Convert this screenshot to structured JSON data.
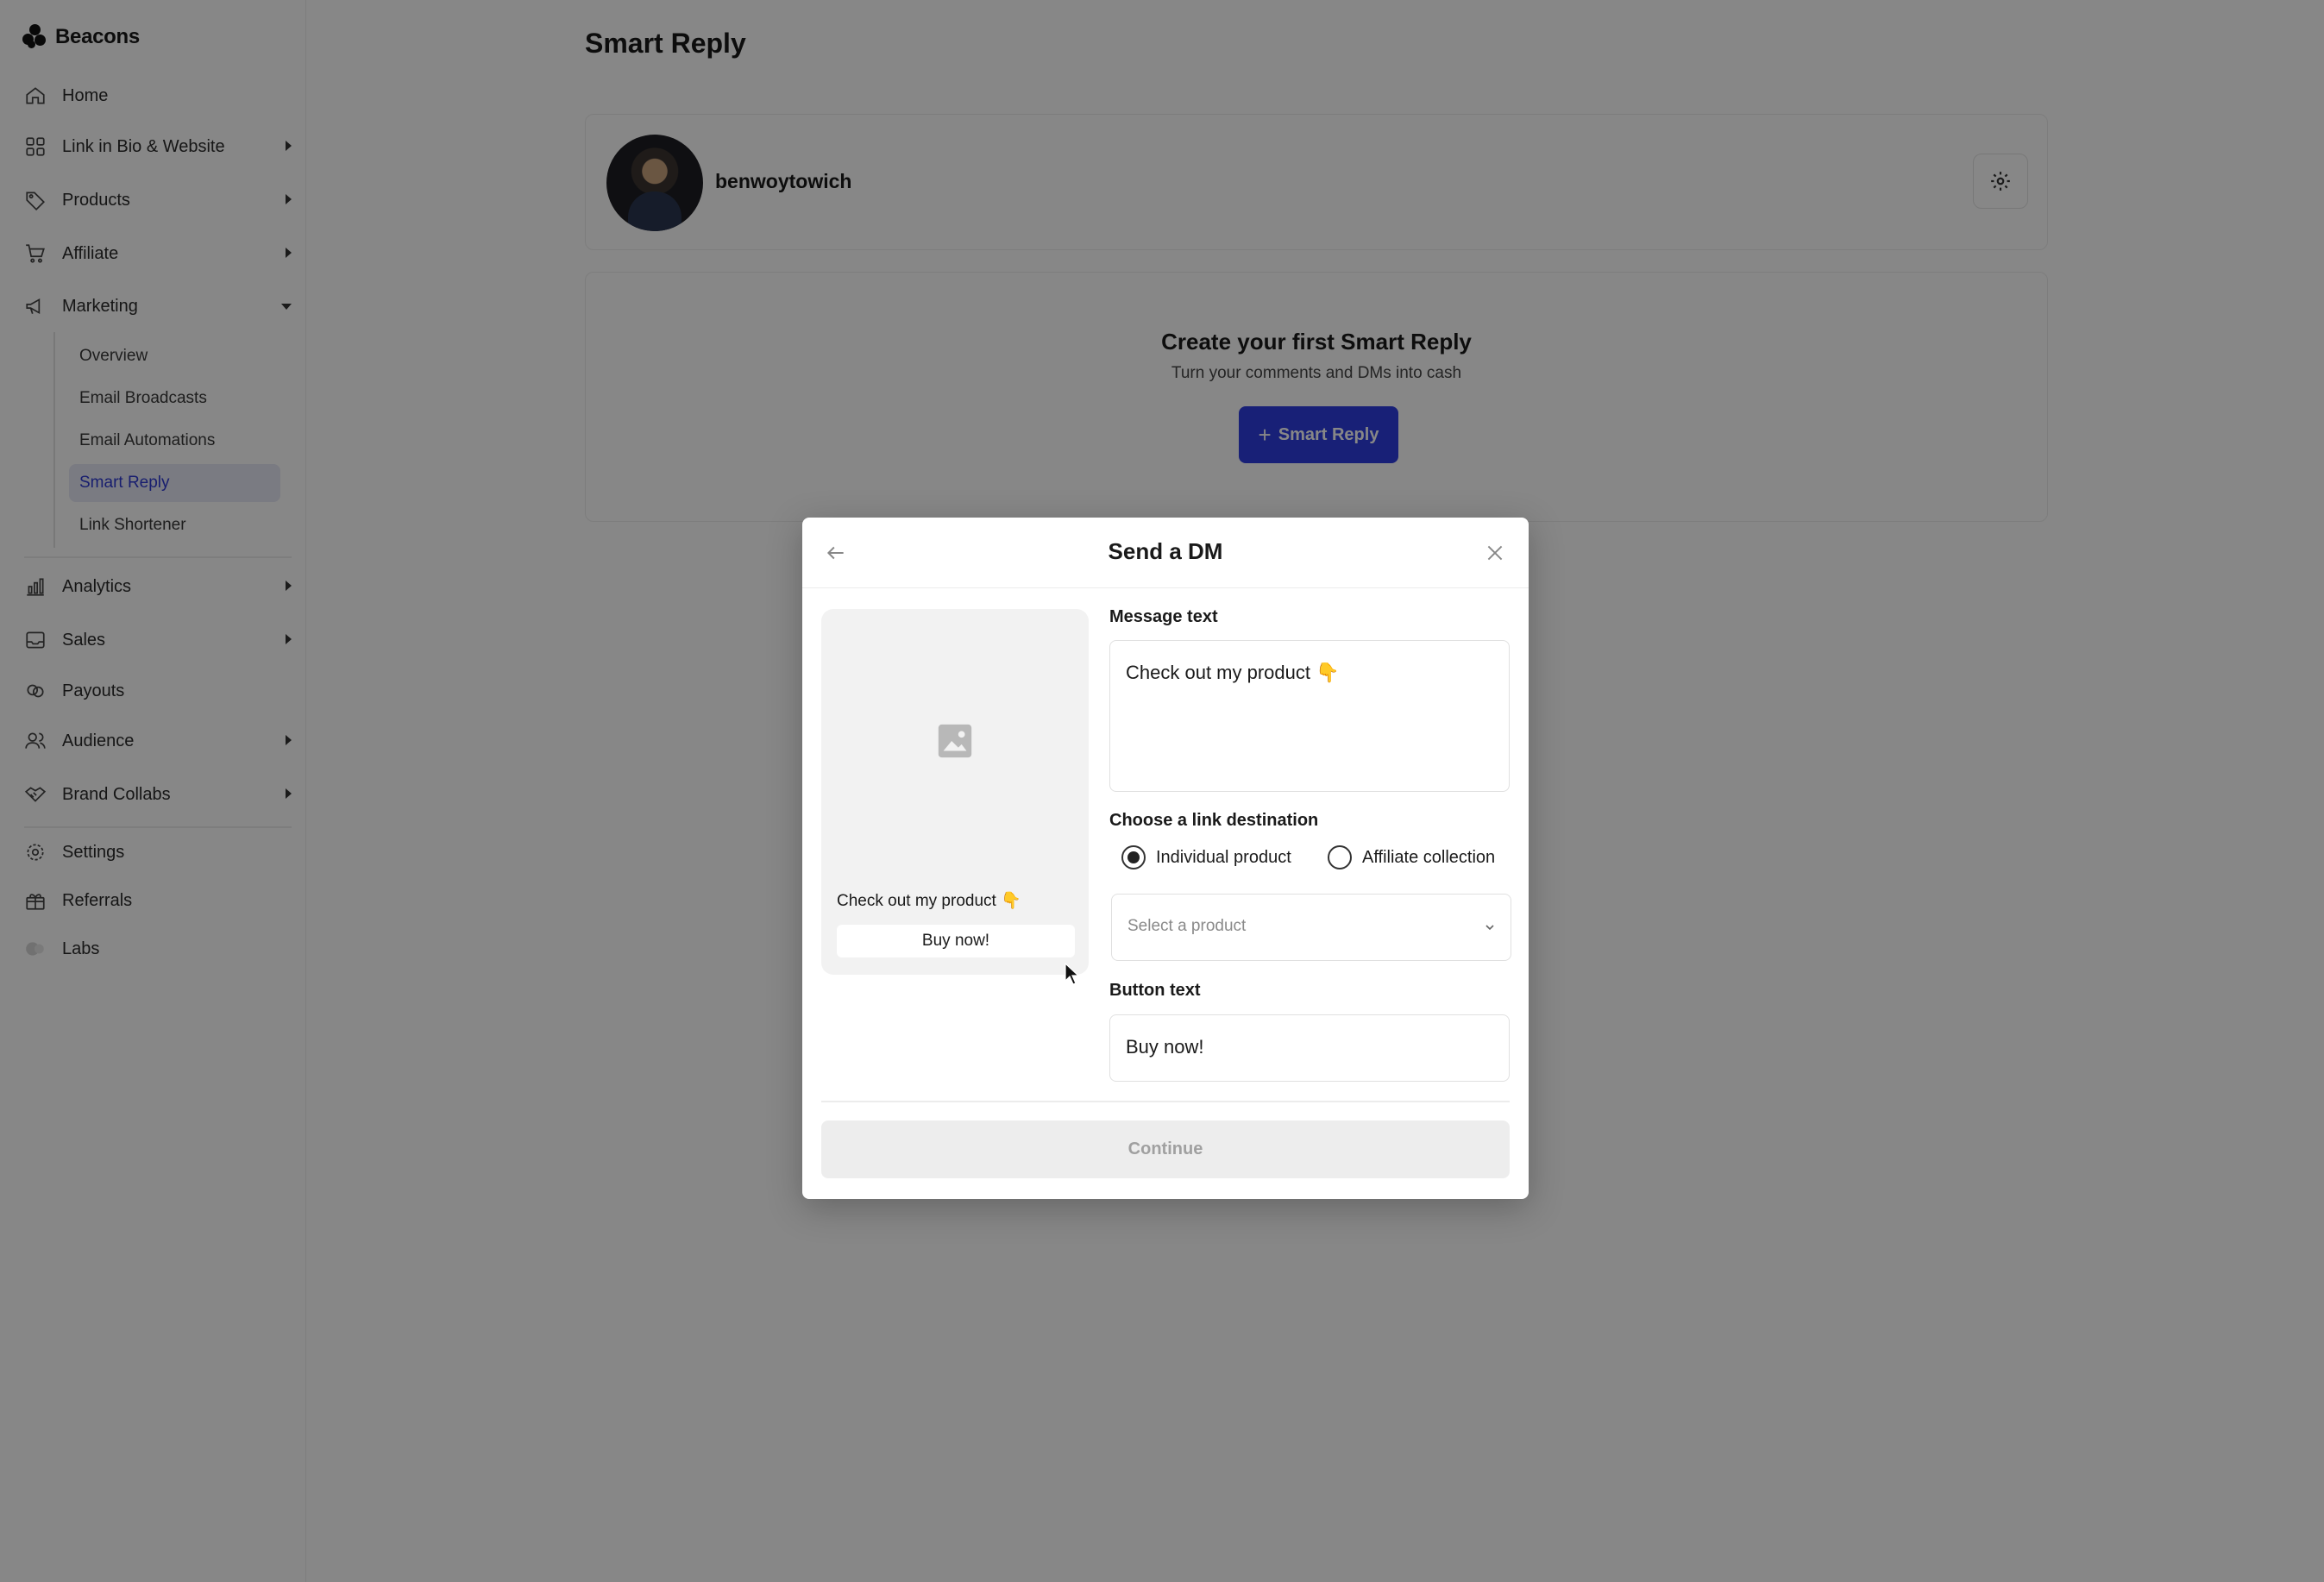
{
  "app": {
    "brand": "Beacons"
  },
  "sidebar": {
    "items": [
      {
        "label": "Home",
        "icon": "home-icon"
      },
      {
        "label": "Link in Bio & Website",
        "icon": "grid-icon"
      },
      {
        "label": "Products",
        "icon": "tag-icon"
      },
      {
        "label": "Affiliate",
        "icon": "cart-icon"
      },
      {
        "label": "Marketing",
        "icon": "megaphone-icon"
      },
      {
        "label": "Analytics",
        "icon": "bar-chart-icon"
      },
      {
        "label": "Sales",
        "icon": "inbox-icon"
      },
      {
        "label": "Payouts",
        "icon": "coins-icon"
      },
      {
        "label": "Audience",
        "icon": "users-icon"
      },
      {
        "label": "Brand Collabs",
        "icon": "handshake-icon"
      },
      {
        "label": "Settings",
        "icon": "gear-icon"
      },
      {
        "label": "Referrals",
        "icon": "gift-icon"
      },
      {
        "label": "Labs",
        "icon": "beaker-icon"
      }
    ],
    "marketing_sub": [
      {
        "label": "Overview"
      },
      {
        "label": "Email Broadcasts"
      },
      {
        "label": "Email Automations"
      },
      {
        "label": "Smart Reply",
        "active": true
      },
      {
        "label": "Link Shortener"
      }
    ]
  },
  "main": {
    "title": "Smart Reply",
    "account": {
      "username": "benwoytowich"
    },
    "empty": {
      "title": "Create your first Smart Reply",
      "subtitle": "Turn your comments and DMs into cash",
      "button_label": "Smart Reply"
    }
  },
  "modal": {
    "title": "Send a DM",
    "preview": {
      "message": "Check out my product 👇",
      "button": "Buy now!"
    },
    "message_label": "Message text",
    "message_value": "Check out my product 👇",
    "link_label": "Choose a link destination",
    "radio_individual": "Individual product",
    "radio_affiliate": "Affiliate collection",
    "selected_radio": "Individual product",
    "select_placeholder": "Select a product",
    "button_text_label": "Button text",
    "button_text_value": "Buy now!",
    "continue_label": "Continue"
  },
  "colors": {
    "accent": "#2f3ee0",
    "active_nav_bg": "#e7e9f5",
    "active_nav_text": "#2e3ad2",
    "overlay": "rgba(0,0,0,0.47)"
  }
}
